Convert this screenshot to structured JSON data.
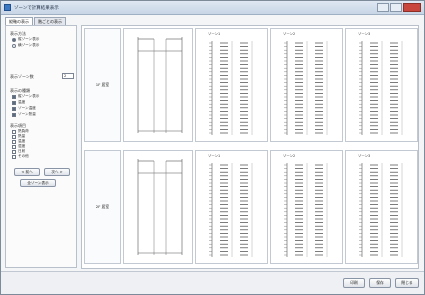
{
  "window": {
    "title": "ゾーンで計算結果表示"
  },
  "tabs": [
    {
      "label": "縦軸の表示"
    },
    {
      "label": "階ごとの表示"
    }
  ],
  "left": {
    "group1_title": "表示方法",
    "group1_opts": [
      "縦ゾーン表示",
      "横ゾーン表示"
    ],
    "spin_label": "表示ゾーン数",
    "spin_value": "2",
    "group2_title": "表示の種類",
    "group2_opts": [
      "縦ゾーン表示",
      "温度",
      "ゾーン温度",
      "ゾーン熱量"
    ],
    "group3_title": "表示項目",
    "group3_opts": [
      "熱負荷",
      "熱量",
      "温度",
      "湿度",
      "日射",
      "その他"
    ],
    "btn_prev": "< 前へ",
    "btn_next": "次へ >",
    "btn_all": "全ゾーン表示"
  },
  "rows": [
    {
      "label": "1F 居室",
      "plots": [
        "ゾーン1",
        "ゾーン2",
        "ゾーン3"
      ]
    },
    {
      "label": "2F 居室",
      "plots": [
        "ゾーン1",
        "ゾーン2",
        "ゾーン3"
      ]
    }
  ],
  "status": {
    "btn_print": "印刷",
    "btn_save": "保存",
    "btn_close": "閉じる"
  }
}
